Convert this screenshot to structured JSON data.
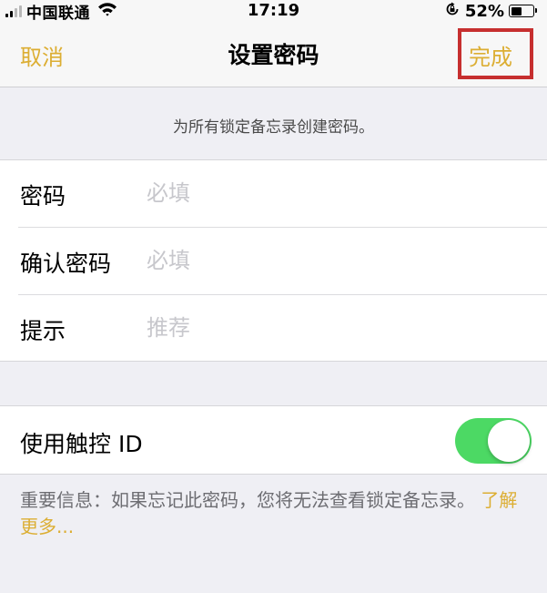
{
  "status_bar": {
    "carrier": "中国联通",
    "time": "17:19",
    "battery_percent": "52%",
    "battery_level": 0.52,
    "icons": [
      "signal-icon",
      "wifi-icon",
      "rotation-lock-icon",
      "battery-icon"
    ]
  },
  "nav": {
    "cancel_label": "取消",
    "title": "设置密码",
    "done_label": "完成"
  },
  "section_header": "为所有锁定备忘录创建密码。",
  "form": {
    "password": {
      "label": "密码",
      "placeholder": "必填",
      "value": ""
    },
    "confirm": {
      "label": "确认密码",
      "placeholder": "必填",
      "value": ""
    },
    "hint": {
      "label": "提示",
      "placeholder": "推荐",
      "value": ""
    }
  },
  "touch_id": {
    "label": "使用触控 ID",
    "enabled": true
  },
  "footer": {
    "note": "重要信息：如果忘记此密码，您将无法查看锁定备忘录。",
    "learn_more": "了解更多..."
  },
  "colors": {
    "accent": "#dcae33",
    "toggle_on": "#4cd964",
    "highlight_box": "#c62f2f",
    "background": "#efeff4"
  }
}
